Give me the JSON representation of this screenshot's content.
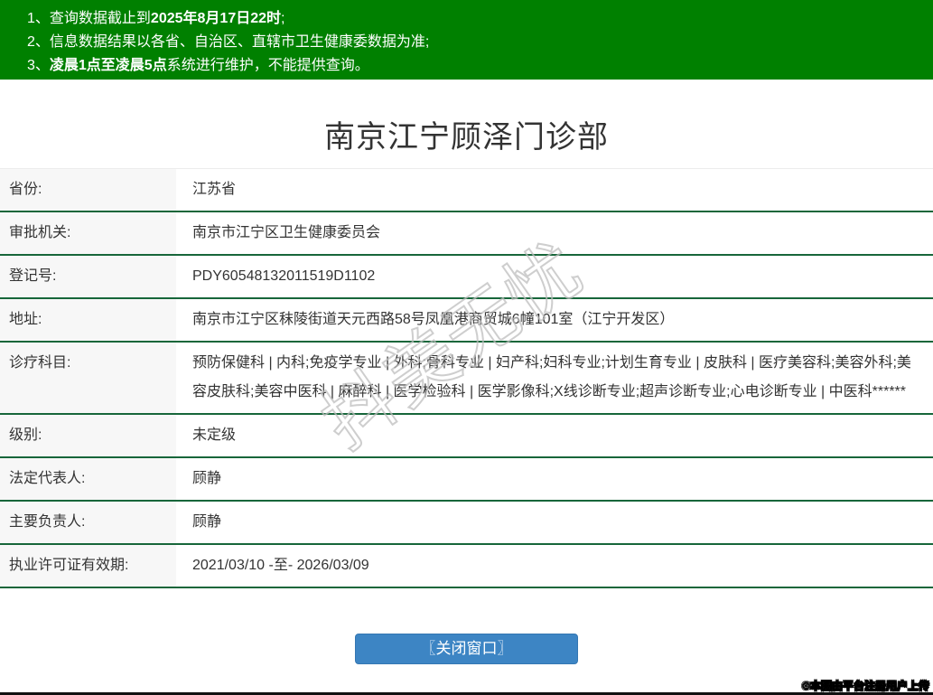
{
  "header": {
    "bg_color": "#008000",
    "notices": [
      {
        "num": "1、",
        "pre": "查询数据截止到",
        "bold": "2025年8月17日22时",
        "post": ";"
      },
      {
        "num": "2、",
        "pre": "信息数据结果以各省、自治区、直辖市卫生健康委数据为准;",
        "bold": "",
        "post": ""
      },
      {
        "num": "3、",
        "pre": "",
        "bold": "凌晨1点至凌晨5点",
        "post": "系统进行维护，不能提供查询。"
      }
    ]
  },
  "title": "南京江宁顾泽门诊部",
  "table": {
    "rows": [
      {
        "label": "省份:",
        "value": "江苏省"
      },
      {
        "label": "审批机关:",
        "value": "南京市江宁区卫生健康委员会"
      },
      {
        "label": "登记号:",
        "value": "PDY60548132011519D1102"
      },
      {
        "label": "地址:",
        "value": "南京市江宁区秣陵街道天元西路58号凤凰港商贸城6幢101室（江宁开发区）"
      },
      {
        "label": "诊疗科目:",
        "value": "预防保健科 | 内科;免疫学专业 | 外科;骨科专业 | 妇产科;妇科专业;计划生育专业 | 皮肤科 | 医疗美容科;美容外科;美容皮肤科;美容中医科 | 麻醉科 | 医学检验科 | 医学影像科;X线诊断专业;超声诊断专业;心电诊断专业 | 中医科******"
      },
      {
        "label": "级别:",
        "value": "未定级"
      },
      {
        "label": "法定代表人:",
        "value": "顾静"
      },
      {
        "label": "主要负责人:",
        "value": "顾静"
      },
      {
        "label": "执业许可证有效期:",
        "value": "2021/03/10 -至- 2026/03/09"
      }
    ]
  },
  "close_button_label": "〖关闭窗口〗",
  "watermark_text": "抖美无忧",
  "footer_credit": "©本图由平台注册用户上传",
  "colors": {
    "header_bg": "#008000",
    "row_separator": "#17663a",
    "label_bg": "#f7f7f7",
    "button_bg": "#3d85c4",
    "text": "#333333"
  }
}
